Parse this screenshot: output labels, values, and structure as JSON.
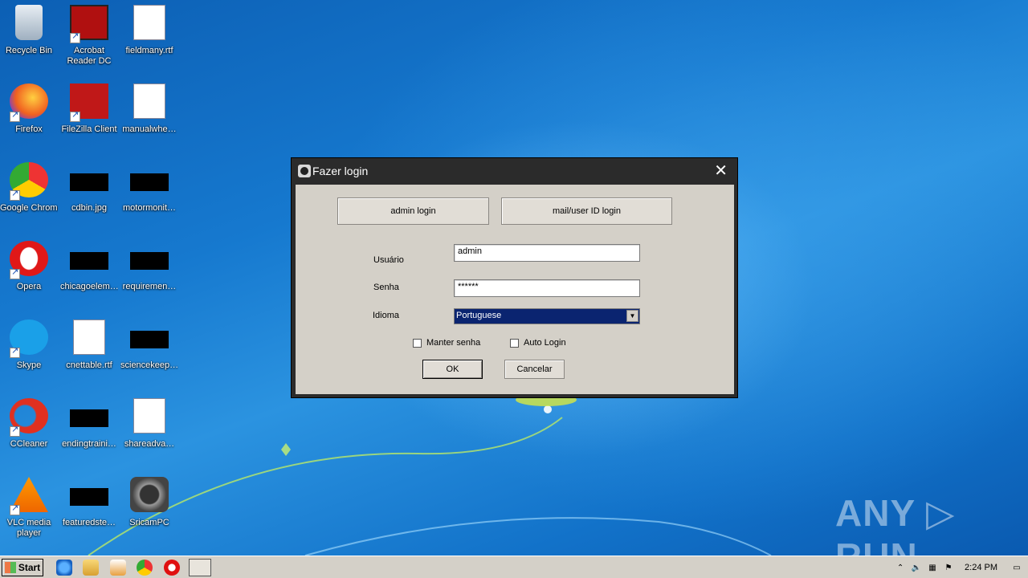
{
  "desktop": {
    "icons": [
      {
        "label": "Recycle Bin",
        "icon": "recycle-bin-icon"
      },
      {
        "label": "Acrobat Reader DC",
        "icon": "acrobat-icon"
      },
      {
        "label": "fieldmany.rtf",
        "icon": "word-doc-icon"
      },
      {
        "label": "Firefox",
        "icon": "firefox-icon"
      },
      {
        "label": "FileZilla Client",
        "icon": "filezilla-icon"
      },
      {
        "label": "manualwhe…",
        "icon": "word-doc-icon"
      },
      {
        "label": "Google Chrome",
        "icon": "chrome-icon"
      },
      {
        "label": "cdbin.jpg",
        "icon": "image-file-icon"
      },
      {
        "label": "motormonit…",
        "icon": "file-icon"
      },
      {
        "label": "Opera",
        "icon": "opera-icon"
      },
      {
        "label": "chicagoelem…",
        "icon": "file-icon"
      },
      {
        "label": "requiremen…",
        "icon": "file-icon"
      },
      {
        "label": "Skype",
        "icon": "skype-icon"
      },
      {
        "label": "cnettable.rtf",
        "icon": "word-doc-icon"
      },
      {
        "label": "sciencekeep…",
        "icon": "file-icon"
      },
      {
        "label": "CCleaner",
        "icon": "ccleaner-icon"
      },
      {
        "label": "endingtraini…",
        "icon": "file-icon"
      },
      {
        "label": "shareadva…",
        "icon": "word-doc-icon"
      },
      {
        "label": "VLC media player",
        "icon": "vlc-icon"
      },
      {
        "label": "featuredste…",
        "icon": "file-icon"
      },
      {
        "label": "SricamPC",
        "icon": "camera-app-icon"
      }
    ]
  },
  "dialog": {
    "title": "Fazer login",
    "close_label": "✕",
    "admin_login_label": "admin login",
    "mail_login_label": "mail/user ID login",
    "user_label": "Usuário",
    "user_value": "admin",
    "password_label": "Senha",
    "password_value": "******",
    "language_label": "Idioma",
    "language_value": "Portuguese",
    "remember_label": "Manter senha",
    "autologin_label": "Auto Login",
    "ok_label": "OK",
    "cancel_label": "Cancelar"
  },
  "watermark": "ANY ▷ RUN",
  "taskbar": {
    "start_label": "Start",
    "clock": "2:24 PM"
  }
}
